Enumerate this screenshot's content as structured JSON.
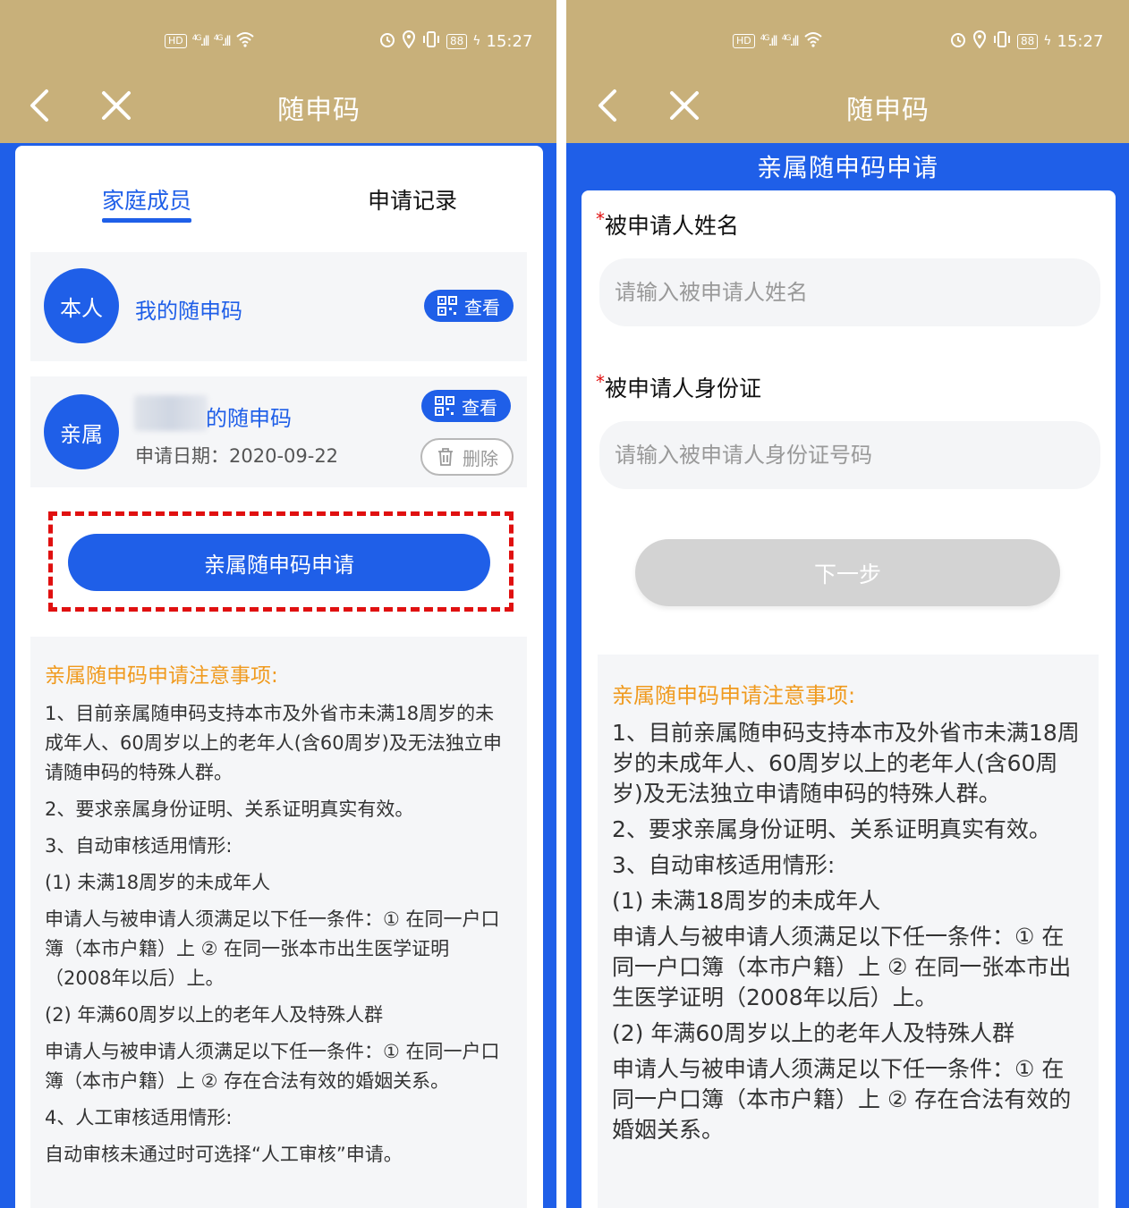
{
  "status_bar": {
    "time": "15:27",
    "battery": "88",
    "network_left": "HD",
    "signal1": "4G",
    "signal2": "4G"
  },
  "left": {
    "title": "随申码",
    "tabs": [
      {
        "label": "家庭成员",
        "active": true
      },
      {
        "label": "申请记录",
        "active": false
      }
    ],
    "members": [
      {
        "avatar": "本人",
        "name": "我的随申码",
        "view_label": "查看"
      },
      {
        "avatar": "亲属",
        "name": "的随申码",
        "date": "申请日期：2020-09-22",
        "view_label": "查看",
        "delete_label": "删除"
      }
    ],
    "apply_button": "亲属随申码申请",
    "notes_title": "亲属随申码申请注意事项:",
    "notes": [
      "1、目前亲属随申码支持本市及外省市未满18周岁的未成年人、60周岁以上的老年人(含60周岁)及无法独立申请随申码的特殊人群。",
      "2、要求亲属身份证明、关系证明真实有效。",
      "3、自动审核适用情形:",
      "(1) 未满18周岁的未成年人",
      "申请人与被申请人须满足以下任一条件：① 在同一户口簿（本市户籍）上 ② 在同一张本市出生医学证明（2008年以后）上。",
      "(2) 年满60周岁以上的老年人及特殊人群",
      "申请人与被申请人须满足以下任一条件：① 在同一户口簿（本市户籍）上 ② 存在合法有效的婚姻关系。",
      "4、人工审核适用情形:",
      "自动审核未通过时可选择“人工审核”申请。"
    ]
  },
  "right": {
    "title": "随申码",
    "subtitle": "亲属随申码申请",
    "name_field": {
      "label": "被申请人姓名",
      "placeholder": "请输入被申请人姓名"
    },
    "id_field": {
      "label": "被申请人身份证",
      "placeholder": "请输入被申请人身份证号码"
    },
    "required_mark": "*",
    "next_button": "下一步",
    "notes_title": "亲属随申码申请注意事项:",
    "notes": [
      "1、目前亲属随申码支持本市及外省市未满18周岁的未成年人、60周岁以上的老年人(含60周岁)及无法独立申请随申码的特殊人群。",
      "2、要求亲属身份证明、关系证明真实有效。",
      "3、自动审核适用情形:",
      "(1) 未满18周岁的未成年人",
      "申请人与被申请人须满足以下任一条件：① 在同一户口簿（本市户籍）上 ② 在同一张本市出生医学证明（2008年以后）上。",
      "(2) 年满60周岁以上的老年人及特殊人群",
      "申请人与被申请人须满足以下任一条件：① 在同一户口簿（本市户籍）上 ② 存在合法有效的婚姻关系。"
    ]
  },
  "colors": {
    "header_gold": "#c8b07a",
    "brand_blue": "#1f5fe8",
    "notes_orange": "#f09a1e",
    "highlight_red": "#e01010"
  },
  "icons": [
    "back-chevron-icon",
    "close-icon",
    "qr-code-icon",
    "trash-icon",
    "alarm-icon",
    "location-icon",
    "vibrate-icon",
    "battery-icon",
    "wifi-icon",
    "signal-icon"
  ]
}
